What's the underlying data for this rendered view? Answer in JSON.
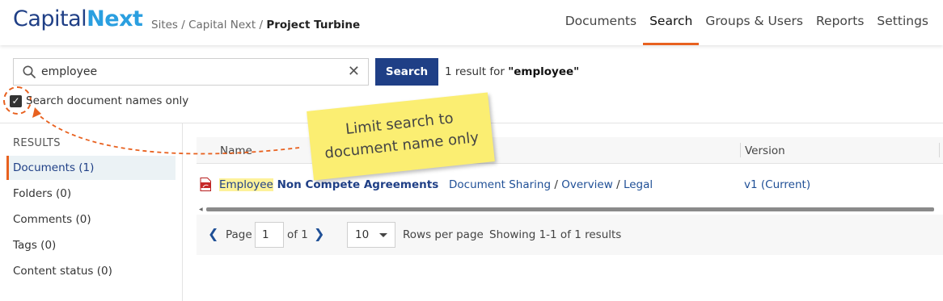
{
  "brand": {
    "part1": "Capital",
    "part2": "Next"
  },
  "breadcrumb": {
    "sites": "Sites",
    "sep1": "/",
    "parent": "Capital Next",
    "sep2": "/",
    "current": "Project Turbine"
  },
  "nav": {
    "documents": "Documents",
    "search": "Search",
    "groups": "Groups & Users",
    "reports": "Reports",
    "settings": "Settings"
  },
  "search": {
    "value": "employee",
    "button": "Search",
    "result_prefix": "1 result for",
    "result_term": "\"employee\"",
    "checkbox_label": "Search document names only",
    "checkbox_checked": true
  },
  "callout": {
    "line1": "Limit search to",
    "line2": "document name only"
  },
  "sidebar": {
    "heading": "RESULTS",
    "items": [
      {
        "label": "Documents (1)",
        "active": true
      },
      {
        "label": "Folders (0)",
        "active": false
      },
      {
        "label": "Comments (0)",
        "active": false
      },
      {
        "label": "Tags (0)",
        "active": false
      },
      {
        "label": "Content status (0)",
        "active": false
      }
    ]
  },
  "table": {
    "columns": {
      "name": "Name",
      "version": "Version"
    },
    "rows": [
      {
        "name_highlight": "Employee",
        "name_rest": " Non Compete Agreements",
        "path": [
          "Document Sharing",
          "Overview",
          "Legal"
        ],
        "path_sep": "/",
        "version": "v1 (Current)",
        "icon": "pdf-icon"
      }
    ]
  },
  "pager": {
    "page_label": "Page",
    "page_value": "1",
    "of_label": "of 1",
    "rows_value": "10",
    "rows_label": "Rows per page",
    "showing": "Showing 1-1 of 1 results"
  },
  "colors": {
    "accent": "#e8611f",
    "primary": "#1f3f86",
    "brand_light": "#2a9fe0",
    "highlight": "#fdf29a",
    "sticky": "#fbee72"
  }
}
